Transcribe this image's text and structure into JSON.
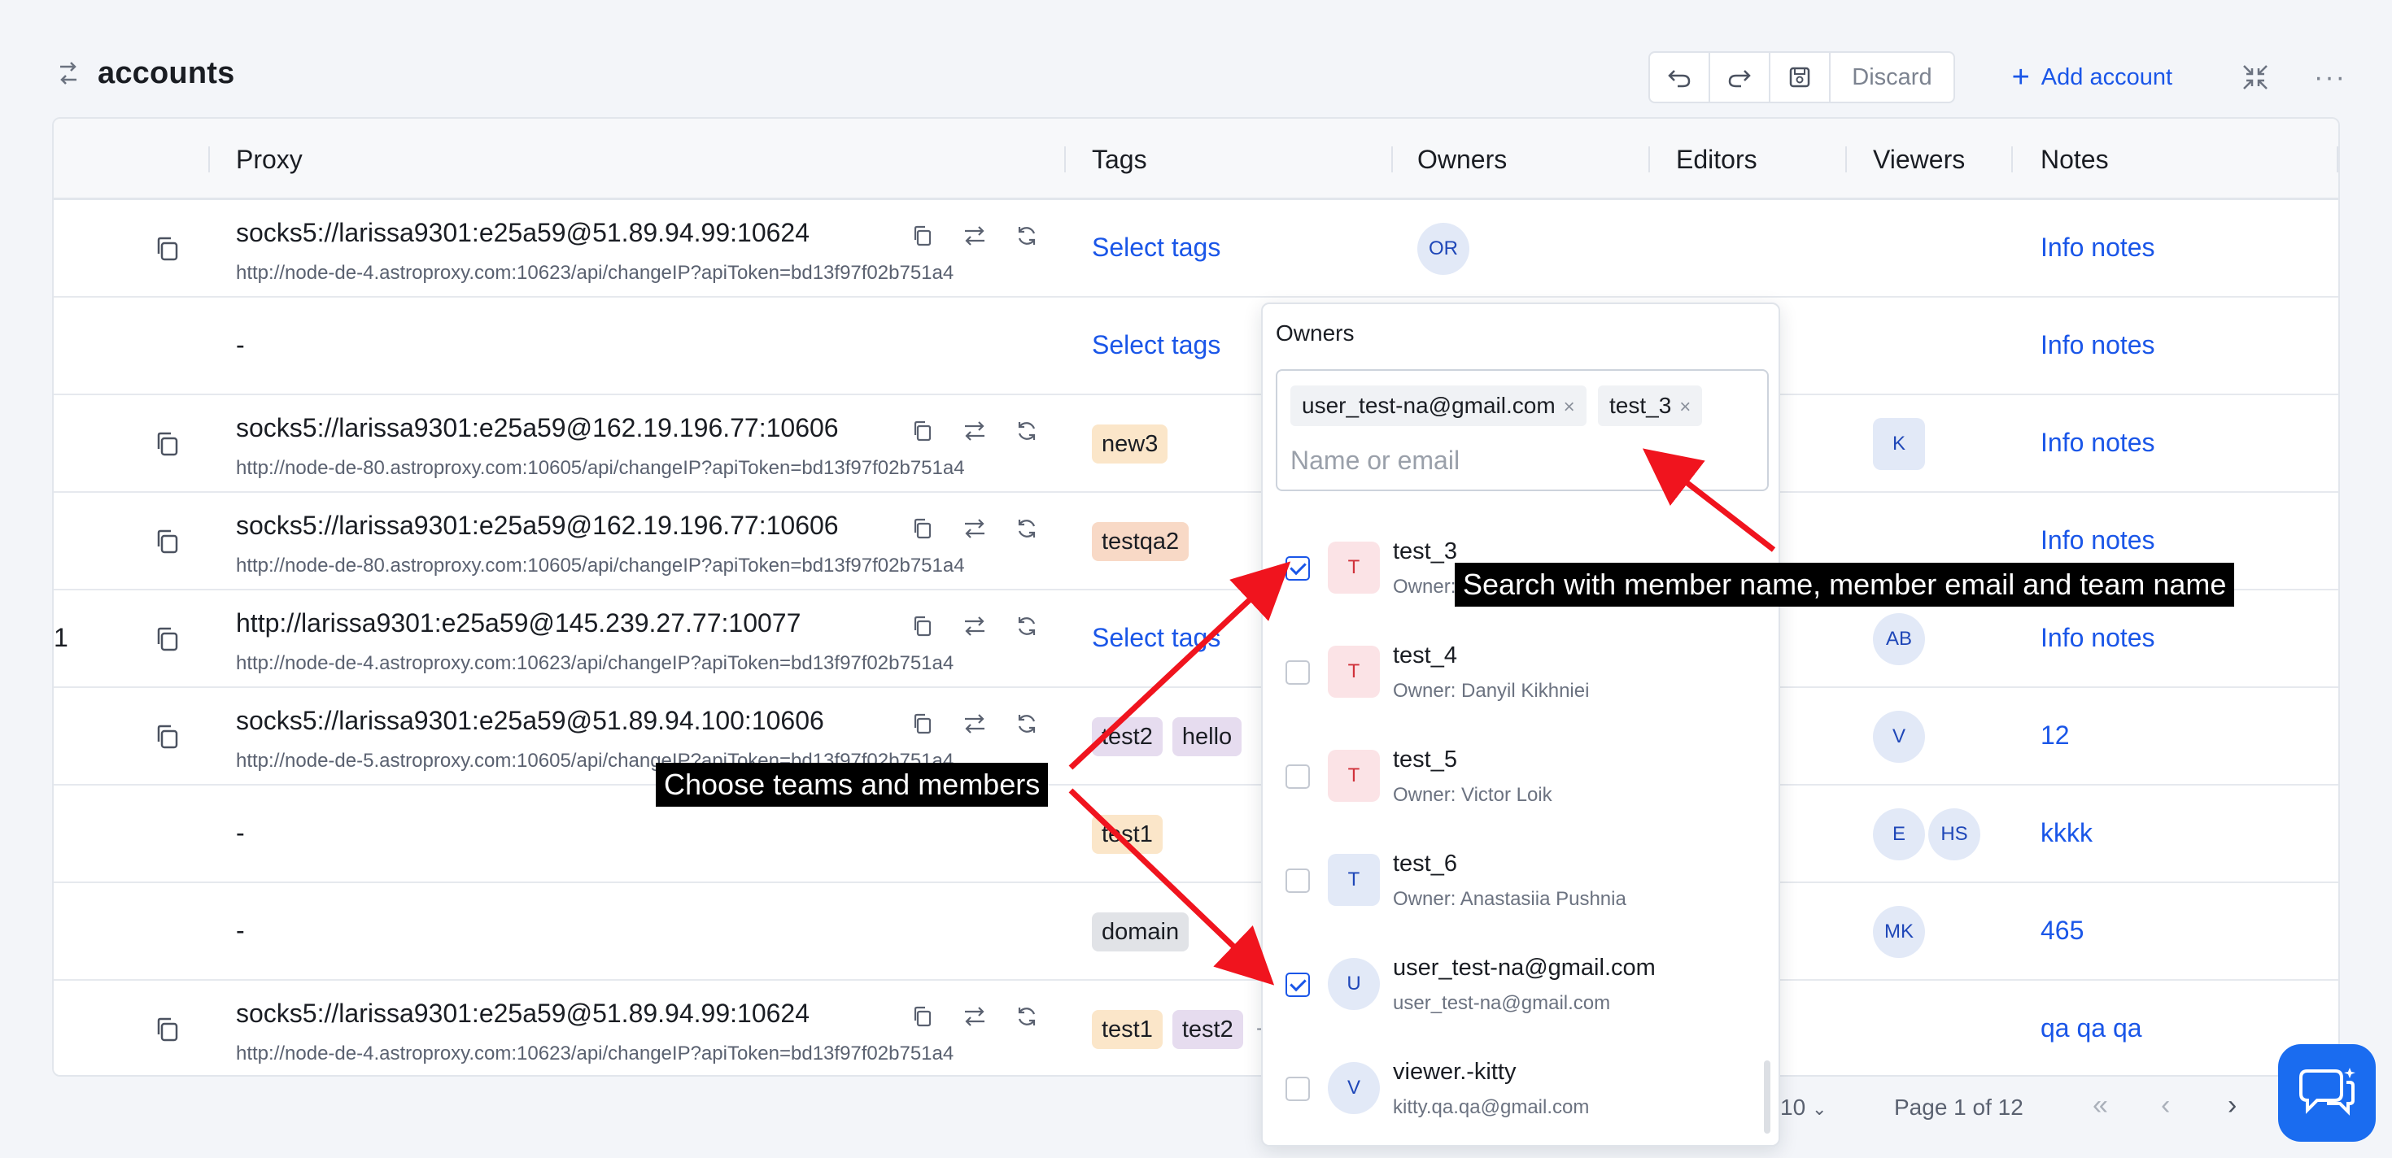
{
  "header": {
    "title": "accounts"
  },
  "toolbar": {
    "discard_label": "Discard",
    "add_label": "Add account",
    "more_label": "···"
  },
  "table": {
    "columns": [
      "Proxy",
      "Tags",
      "Owners",
      "Editors",
      "Viewers",
      "Notes"
    ],
    "rows": [
      {
        "proxy": "socks5://larissa9301:e25a59@51.89.94.99:10624",
        "sub": "http://node-de-4.astroproxy.com:10623/api/changeIP?apiToken=bd13f97f02b751a4",
        "tags": [],
        "select_tags": "Select tags",
        "owners": [
          "OR"
        ],
        "viewers": [],
        "notes": "Info notes"
      },
      {
        "proxy": "-",
        "sub": "",
        "tags": [],
        "select_tags": "Select tags",
        "owners": [],
        "viewers": [],
        "notes": "Info notes"
      },
      {
        "proxy": "socks5://larissa9301:e25a59@162.19.196.77:10606",
        "sub": "http://node-de-80.astroproxy.com:10605/api/changeIP?apiToken=bd13f97f02b751a4",
        "tags": [
          "new3"
        ],
        "owners": [],
        "viewers": [
          "K"
        ],
        "notes": "Info notes"
      },
      {
        "proxy": "socks5://larissa9301:e25a59@162.19.196.77:10606",
        "sub": "http://node-de-80.astroproxy.com:10605/api/changeIP?apiToken=bd13f97f02b751a4",
        "tags": [
          "testqa2"
        ],
        "owners": [],
        "viewers": [],
        "notes": "Info notes"
      },
      {
        "num": "1",
        "proxy": "http://larissa9301:e25a59@145.239.27.77:10077",
        "sub": "http://node-de-4.astroproxy.com:10623/api/changeIP?apiToken=bd13f97f02b751a4",
        "tags": [],
        "select_tags": "Select tags",
        "owners": [],
        "viewers": [
          "AB"
        ],
        "notes": "Info notes"
      },
      {
        "proxy": "socks5://larissa9301:e25a59@51.89.94.100:10606",
        "sub": "http://node-de-5.astroproxy.com:10605/api/changeIP?apiToken=bd13f97f02b751a4",
        "tags": [
          "test2",
          "hello"
        ],
        "owners": [],
        "viewers": [
          "V"
        ],
        "notes": "12"
      },
      {
        "proxy": "-",
        "sub": "",
        "tags": [
          "test1"
        ],
        "owners": [],
        "viewers": [
          "E",
          "HS"
        ],
        "notes": "kkkk"
      },
      {
        "proxy": "-",
        "sub": "",
        "tags": [
          "domain"
        ],
        "owners": [],
        "viewers": [
          "MK"
        ],
        "notes": "465"
      },
      {
        "proxy": "socks5://larissa9301:e25a59@51.89.94.99:10624",
        "sub": "http://node-de-4.astroproxy.com:10623/api/changeIP?apiToken=bd13f97f02b751a4",
        "tags": [
          "test1",
          "test2",
          "+"
        ],
        "owners": [],
        "viewers": [],
        "notes": "qa qa qa"
      }
    ]
  },
  "pagination": {
    "page_size": "10",
    "page_label": "Page 1 of 12"
  },
  "dropdown": {
    "label": "Owners",
    "chips": [
      "user_test-na@gmail.com",
      "test_3"
    ],
    "chip_remove": "×",
    "placeholder": "Name or email",
    "items": [
      {
        "initial": "T",
        "name": "test_3",
        "sub": "Owner:",
        "checked": true,
        "kind": "team-red"
      },
      {
        "initial": "T",
        "name": "test_4",
        "sub": "Owner: Danyil Kikhniei",
        "checked": false,
        "kind": "team-red"
      },
      {
        "initial": "T",
        "name": "test_5",
        "sub": "Owner: Victor Loik",
        "checked": false,
        "kind": "team-red"
      },
      {
        "initial": "T",
        "name": "test_6",
        "sub": "Owner: Anastasiia Pushnia",
        "checked": false,
        "kind": "team-blue"
      },
      {
        "initial": "U",
        "name": "user_test-na@gmail.com",
        "sub": "user_test-na@gmail.com",
        "checked": true,
        "kind": "user"
      },
      {
        "initial": "V",
        "name": "viewer.-kitty",
        "sub": "kitty.qa.qa@gmail.com",
        "checked": false,
        "kind": "user"
      }
    ]
  },
  "annotations": {
    "search_callout": "Search with member name, member email and team name",
    "choose_callout": "Choose teams and members",
    "arrow_color": "#f0141e"
  }
}
